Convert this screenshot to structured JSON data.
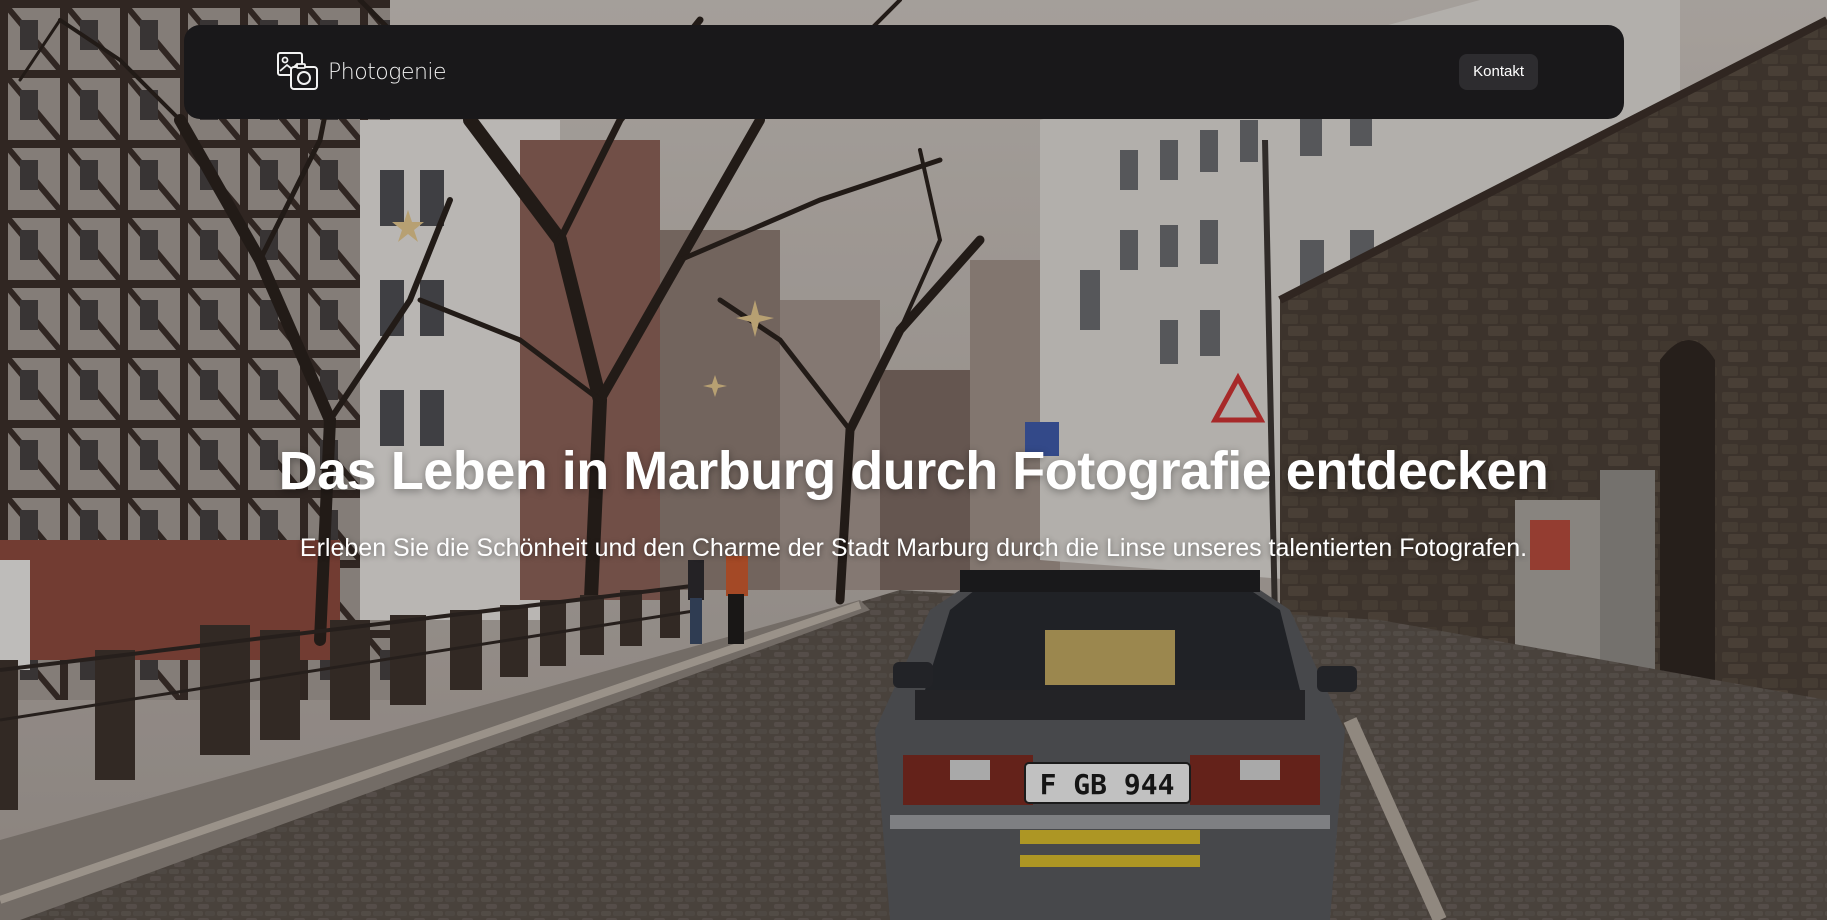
{
  "navbar": {
    "logo": {
      "icon": "photo-camera-icon",
      "text": "Photogenie"
    },
    "contact_button": "Kontakt"
  },
  "hero": {
    "title": "Das Leben in Marburg durch Fotografie entdecken",
    "subtitle": "Erleben Sie die Schönheit und den Charme der Stadt Marburg durch die Linse unseres talentierten Fotografen.",
    "background": {
      "license_plate": "F GB 944"
    }
  },
  "colors": {
    "navbar_bg": "#19181a",
    "button_bg": "#2d2c2f",
    "text": "#ffffff"
  }
}
